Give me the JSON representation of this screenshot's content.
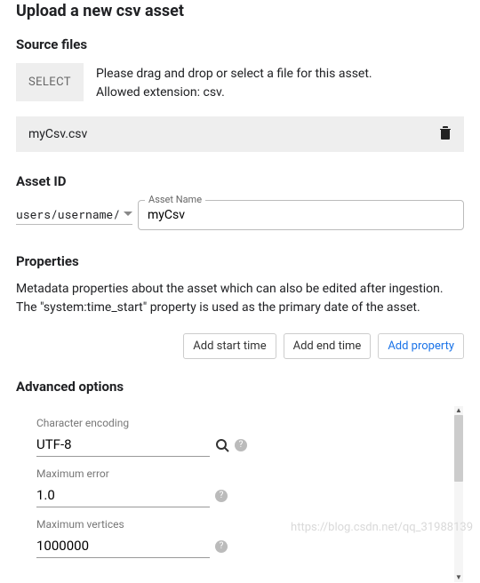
{
  "title": "Upload a new csv asset",
  "source": {
    "heading": "Source files",
    "select_label": "SELECT",
    "hint1": "Please drag and drop or select a file for this asset.",
    "hint2": "Allowed extension: csv.",
    "file_name": "myCsv.csv"
  },
  "asset_id": {
    "heading": "Asset ID",
    "prefix": "users/username/",
    "name_label": "Asset Name",
    "name_value": "myCsv"
  },
  "properties": {
    "heading": "Properties",
    "desc": "Metadata properties about the asset which can also be edited after ingestion. The \"system:time_start\" property is used as the primary date of the asset.",
    "add_start": "Add start time",
    "add_end": "Add end time",
    "add_prop": "Add property"
  },
  "advanced": {
    "heading": "Advanced options",
    "char_enc_label": "Character encoding",
    "char_enc_value": "UTF-8",
    "max_err_label": "Maximum error",
    "max_err_value": "1.0",
    "max_vert_label": "Maximum vertices",
    "max_vert_value": "1000000"
  },
  "watermark": "https://blog.csdn.net/qq_31988139"
}
